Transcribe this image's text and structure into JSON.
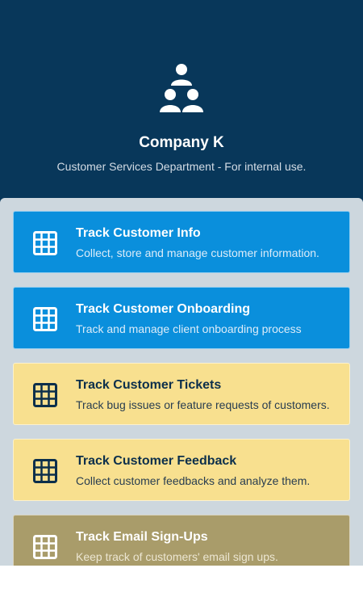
{
  "header": {
    "logo_icon": "team-people-icon",
    "company_name": "Company K",
    "subtitle": "Customer Services Department - For internal use."
  },
  "apps": [
    {
      "title": "Track Customer Info",
      "description": "Collect, store and manage customer information.",
      "icon": "table-grid-icon",
      "color": "#0a8fdc"
    },
    {
      "title": "Track Customer Onboarding",
      "description": "Track and manage client onboarding process",
      "icon": "table-grid-icon",
      "color": "#0a8fdc"
    },
    {
      "title": "Track Customer Tickets",
      "description": "Track bug issues or feature requests of customers.",
      "icon": "table-grid-icon",
      "color": "#f8e08f"
    },
    {
      "title": "Track Customer Feedback",
      "description": "Collect customer feedbacks and analyze them.",
      "icon": "table-grid-icon",
      "color": "#f8e08f"
    },
    {
      "title": "Track Email Sign-Ups",
      "description": "Keep track of customers' email sign ups.",
      "icon": "table-grid-icon",
      "color": "#a99c6a"
    }
  ]
}
